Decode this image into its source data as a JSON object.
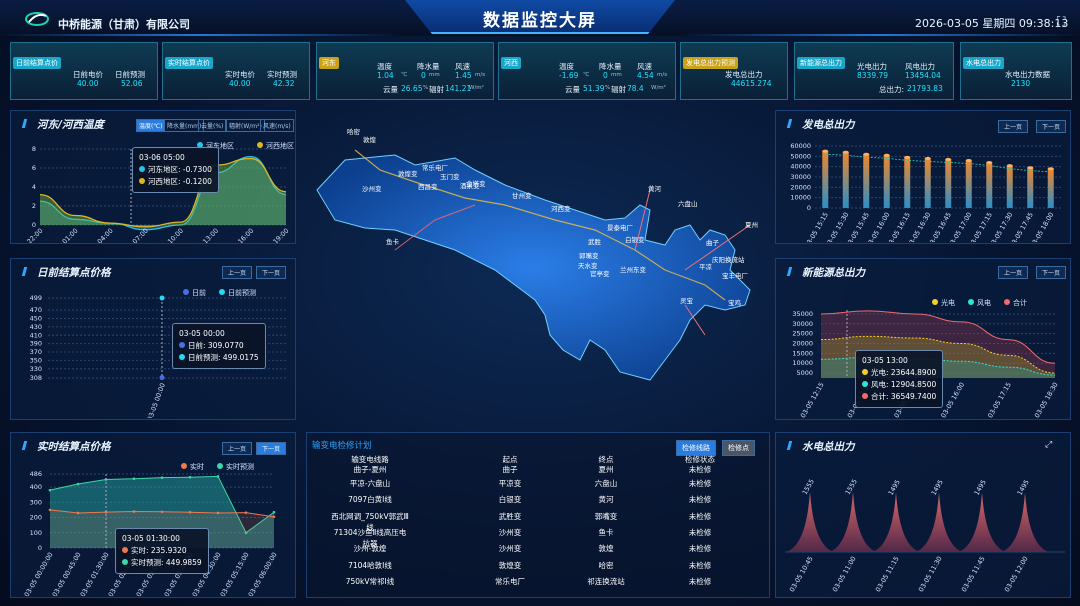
{
  "header": {
    "company": "中桥能源（甘肃）有限公司",
    "title": "数据监控大屏",
    "datetime": "2026-03-05 星期四 09:38:13"
  },
  "cards": [
    {
      "tag": "日前结算点价",
      "k1": "日前电价",
      "v1": "40.00",
      "k2": "日前预测",
      "v2": "52.06",
      "tag_color": "#1aa6c8"
    },
    {
      "tag": "实时结算点价",
      "k1": "实时电价",
      "v1": "40.00",
      "k2": "实时预测",
      "v2": "42.32",
      "tag_color": "#1aa6c8"
    },
    {
      "tag": "河东",
      "k1": "温度",
      "v1": "1.04",
      "u1": "℃",
      "k2": "降水量",
      "v2": "0",
      "u2": "mm",
      "k3": "风速",
      "v3": "1.45",
      "u3": "m/s",
      "k4": "云量",
      "v4": "26.65",
      "u4": "%",
      "k5": "辐射",
      "v5": "141.21",
      "u5": "W/m²",
      "tag_color": "#c9a21a"
    },
    {
      "tag": "河西",
      "k1": "温度",
      "v1": "-1.69",
      "u1": "℃",
      "k2": "降水量",
      "v2": "0",
      "u2": "mm",
      "k3": "风速",
      "v3": "4.54",
      "u3": "m/s",
      "k4": "云量",
      "v4": "51.39",
      "u4": "%",
      "k5": "辐射",
      "v5": "78.4",
      "u5": "W/m²",
      "tag_color": "#1aa6c8"
    },
    {
      "tag": "发电总出力预测",
      "k1": "发电总出力",
      "v1": "44615.274",
      "tag_color": "#c9a21a"
    },
    {
      "tag": "新能源总出力",
      "k1": "光电出力",
      "v1": "8339.79",
      "k2": "风电出力",
      "v2": "13454.04",
      "k3": "总出力:",
      "v3": "21793.83",
      "tag_color": "#1aa6c8"
    },
    {
      "tag": "水电总出力",
      "k1": "水电出力数据",
      "v1": "2130",
      "tag_color": "#1aa6c8"
    }
  ],
  "temp_panel": {
    "title": "河东/河西温度",
    "tabs": [
      "温度(℃)",
      "降水量(mm)",
      "云量(%)",
      "辐射(W/m²)",
      "风速(m/s)"
    ],
    "legend": [
      "河东地区",
      "河西地区"
    ],
    "tooltip": {
      "time": "03-06 05:00",
      "l1": "河东地区: -0.7300",
      "l2": "河西地区: -0.1200"
    },
    "chart_data": {
      "type": "area",
      "x": [
        "03-05 22:00",
        "03-06 01:00",
        "03-06 04:00",
        "03-06 07:00",
        "03-06 10:00",
        "03-06 13:00",
        "03-06 16:00",
        "03-06 19:00"
      ],
      "ylim": [
        0,
        8
      ],
      "yticks": [
        0,
        2,
        4,
        6,
        8
      ],
      "series": [
        {
          "name": "河东地区",
          "values": [
            2.5,
            0.6,
            0.2,
            -0.5,
            0,
            5.5,
            7.2,
            3.2
          ]
        },
        {
          "name": "河西地区",
          "values": [
            3.2,
            1,
            0.2,
            -0.2,
            0.3,
            6.3,
            7,
            3.5
          ]
        }
      ]
    }
  },
  "dayahead_panel": {
    "title": "日前结算点价格",
    "prev": "上一页",
    "next": "下一页",
    "legend": [
      "日前",
      "日前预测"
    ],
    "tooltip": {
      "time": "03-05 00:00",
      "l1": "日前: 309.0770",
      "l2": "日前预测: 499.0175"
    },
    "chart_data": {
      "type": "scatter",
      "x": [
        "03-05 00:00"
      ],
      "yticks": [
        308,
        330,
        350,
        370,
        390,
        410,
        430,
        450,
        470,
        499
      ],
      "series": [
        {
          "name": "日前",
          "values": [
            309.077
          ]
        },
        {
          "name": "日前预测",
          "values": [
            499.0175
          ]
        }
      ]
    }
  },
  "realtime_panel": {
    "title": "实时结算点价格",
    "prev": "上一页",
    "next": "下一页",
    "legend": [
      "实时",
      "实时预测"
    ],
    "tooltip": {
      "time": "03-05 01:30:00",
      "l1": "实时: 235.9320",
      "l2": "实时预测: 449.9859"
    },
    "chart_data": {
      "type": "area",
      "x": [
        "03-05 00:00:00",
        "03-05 00:45:00",
        "03-05 01:30:00",
        "03-05 02:15:00",
        "03-05 03:00:00",
        "03-05 03:45:00",
        "03-05 04:30:00",
        "03-05 05:15:00",
        "03-05 06:00:00"
      ],
      "yticks": [
        0,
        100,
        200,
        300,
        400,
        486
      ],
      "series": [
        {
          "name": "实时",
          "values": [
            250,
            230,
            236,
            240,
            238,
            235,
            230,
            232,
            205
          ]
        },
        {
          "name": "实时预测",
          "values": [
            380,
            420,
            450,
            455,
            462,
            465,
            470,
            100,
            235
          ]
        }
      ]
    }
  },
  "power_panel": {
    "title": "发电总出力",
    "prev": "上一页",
    "next": "下一页",
    "chart_data": {
      "type": "bar",
      "categories": [
        "03-05 15:15",
        "03-05 15:30",
        "03-05 15:45",
        "03-05 16:00",
        "03-05 16:15",
        "03-05 16:30",
        "03-05 16:45",
        "03-05 17:00",
        "03-05 17:15",
        "03-05 17:30",
        "03-05 17:45",
        "03-05 18:00"
      ],
      "yticks": [
        0,
        10000,
        20000,
        30000,
        40000,
        50000,
        60000
      ],
      "values": [
        55000,
        54000,
        52000,
        51000,
        49000,
        48000,
        47000,
        46000,
        44000,
        41000,
        39000,
        38000
      ]
    }
  },
  "newenergy_panel": {
    "title": "新能源总出力",
    "prev": "上一页",
    "next": "下一页",
    "legend": [
      "光电",
      "风电",
      "合计"
    ],
    "tooltip": {
      "time": "03-05 13:00",
      "l1": "光电: 23644.8900",
      "l2": "风电: 12904.8500",
      "l3": "合计: 36549.7400"
    },
    "chart_data": {
      "type": "area",
      "x": [
        "03-05 12:15",
        "03-05 13:30",
        "03-05 14:45",
        "03-05 16:00",
        "03-05 17:15",
        "03-05 18:30"
      ],
      "yticks": [
        5000,
        10000,
        15000,
        20000,
        25000,
        30000,
        35000
      ],
      "series": [
        {
          "name": "光电",
          "values": [
            22000,
            23644,
            22800,
            20000,
            14000,
            5000
          ]
        },
        {
          "name": "风电",
          "values": [
            12000,
            12904,
            12300,
            11000,
            8000,
            4000
          ]
        },
        {
          "name": "合计",
          "values": [
            35000,
            36549,
            35000,
            31000,
            22000,
            10000
          ]
        }
      ]
    }
  },
  "hydro_panel": {
    "title": "水电总出力",
    "chart_data": {
      "type": "area",
      "x": [
        "03-05 10:45",
        "03-05 11:00",
        "03-05 11:15",
        "03-05 11:30",
        "03-05 11:45",
        "03-05 12:00"
      ],
      "series": [
        {
          "name": "水电",
          "values": [
            1555,
            1555,
            1495,
            1495,
            1495,
            1495
          ]
        }
      ]
    }
  },
  "maint": {
    "title": "输变电检修计划",
    "btn1": "检修线路",
    "btn2": "检修点",
    "headers": [
      "输变电线路",
      "起点",
      "终点",
      "检修状态"
    ],
    "rows": [
      [
        "曲子-夏州",
        "曲子",
        "夏州",
        "未检修"
      ],
      [
        "平凉-六盘山",
        "平凉变",
        "六盘山",
        "未检修"
      ],
      [
        "7097白黄Ⅰ线",
        "白银变",
        "黄河",
        "未检修"
      ],
      [
        "西北网调_750kV郭武Ⅲ线",
        "武胜变",
        "郭嘴变",
        "未检修"
      ],
      [
        "71304沙鱼Ⅱ线高压电抗器",
        "沙州变",
        "鱼卡",
        "未检修"
      ],
      [
        "沙州-敦煌",
        "沙州变",
        "敦煌",
        "未检修"
      ],
      [
        "7104哈敦Ⅰ线",
        "敦煌变",
        "哈密",
        "未检修"
      ],
      [
        "750kV常祁Ⅰ线",
        "常乐电厂",
        "祁连换流站",
        "未检修"
      ]
    ]
  },
  "map": {
    "labels": [
      "哈密",
      "敦煌",
      "沙州变",
      "敦煌变",
      "常乐电厂",
      "玉门变",
      "西昌变",
      "金塔变",
      "酒泉变",
      "鱼卡",
      "甘州变",
      "河西变",
      "黄河",
      "景泰电厂",
      "白银变",
      "武胜",
      "郭嘴变",
      "天水变",
      "兰州东变",
      "官亭变",
      "平凉",
      "六盘山",
      "曲子",
      "庆阳换流站",
      "宝鸡",
      "夏州",
      "宝丰电厂",
      "灵宝"
    ]
  }
}
